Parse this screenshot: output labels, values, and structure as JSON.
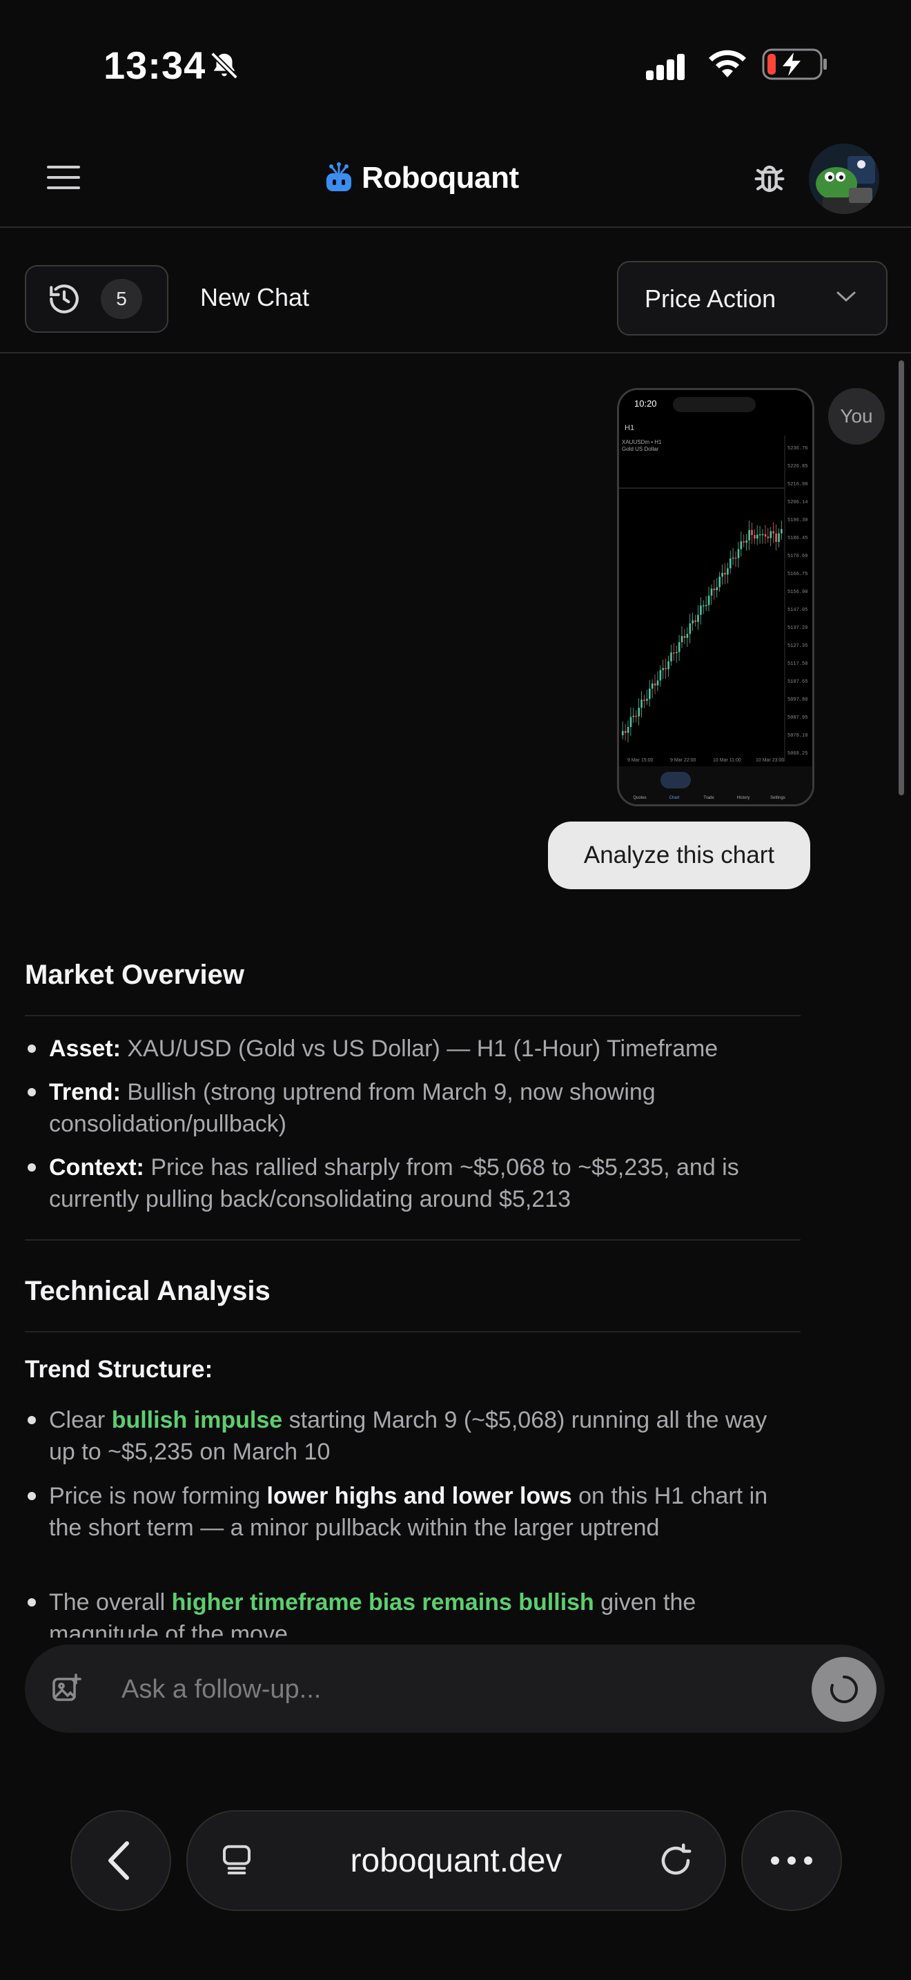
{
  "status_bar": {
    "time": "13:34"
  },
  "header": {
    "brand": "Roboquant"
  },
  "toolbar": {
    "history_count": "5",
    "new_chat_label": "New Chat",
    "mode_selected": "Price Action"
  },
  "chat": {
    "user_label": "You",
    "user_message": "Analyze this chart",
    "thumbnail": {
      "time": "10:20",
      "symbol": "XAUUSDm • H1",
      "description": "Gold US Dollar",
      "timeframe": "H1",
      "price_labels": [
        "5236.76",
        "5226.85",
        "5216.98",
        "5206.14",
        "5196.30",
        "5186.45",
        "5176.60",
        "5166.75",
        "5156.90",
        "5147.05",
        "5137.20",
        "5127.35",
        "5117.50",
        "5107.65",
        "5097.80",
        "5087.95",
        "5078.10",
        "5068.25"
      ],
      "date_labels": [
        "9 Mar 15:00",
        "9 Mar 22:00",
        "10 Mar 11:00",
        "10 Mar 23:00"
      ],
      "nav": [
        "Quotes",
        "Chart",
        "Trade",
        "History",
        "Settings"
      ]
    },
    "market_overview": {
      "title": "Market Overview",
      "asset_label": "Asset:",
      "asset_text": " XAU/USD (Gold vs US Dollar) — H1 (1-Hour) Timeframe",
      "trend_label": "Trend:",
      "trend_text": " Bullish (strong uptrend from March 9, now showing consolidation/pullback)",
      "context_label": "Context:",
      "context_text": " Price has rallied sharply from ~$5,068 to ~$5,235, and is currently pulling back/consolidating around $5,213"
    },
    "technical_analysis": {
      "title": "Technical Analysis",
      "subtitle": "Trend Structure:",
      "b1_pre": "Clear ",
      "b1_hl": "bullish impulse",
      "b1_post": " starting March 9 (~$5,068) running all the way up to ~$5,235 on March 10",
      "b2_pre": "Price is now forming ",
      "b2_hl": "lower highs and lower lows",
      "b2_post": " on this H1 chart in the short term — a minor pullback within the larger uptrend",
      "b3_pre": "The overall ",
      "b3_hl": "higher timeframe bias remains bullish",
      "b3_post": " given the magnitude of the move"
    }
  },
  "composer": {
    "placeholder": "Ask a follow-up..."
  },
  "browser": {
    "url": "roboquant.dev"
  },
  "colors": {
    "accent_green": "#5ccf6e",
    "brand_blue": "#3b8ef0",
    "bg": "#0b0b0c"
  }
}
